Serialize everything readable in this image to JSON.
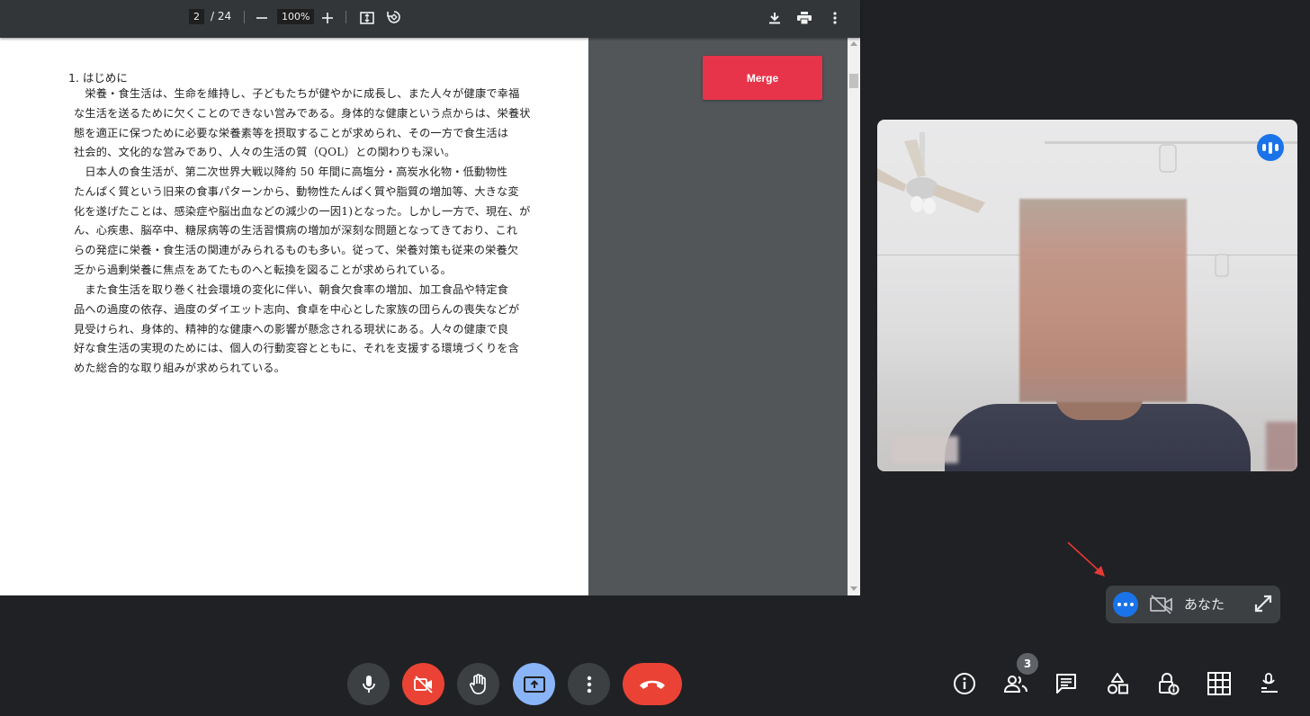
{
  "pdf_viewer": {
    "current_page": "2",
    "total_pages": "/ 24",
    "zoom": "100%",
    "heading": "1. はじめに",
    "paragraphs": [
      [
        "　栄養・食生活は、生命を維持し、子どもたちが健やかに成長し、また人々が健康で幸福",
        "な生活を送るために欠くことのできない営みである。身体的な健康という点からは、栄養状",
        "態を適正に保つために必要な栄養素等を摂取することが求められ、その一方で食生活は",
        "社会的、文化的な営みであり、人々の生活の質（QOL）との関わりも深い。"
      ],
      [
        "　日本人の食生活が、第二次世界大戦以降約 50 年間に高塩分・高炭水化物・低動物性",
        "たんぱく質という旧来の食事パターンから、動物性たんぱく質や脂質の増加等、大きな変",
        "化を遂げたことは、感染症や脳出血などの減少の一因1)となった。しかし一方で、現在、が",
        "ん、心疾患、脳卒中、糖尿病等の生活習慣病の増加が深刻な問題となってきており、これ",
        "らの発症に栄養・食生活の関連がみられるものも多い。従って、栄養対策も従来の栄養欠",
        "乏から過剰栄養に焦点をあてたものへと転換を図ることが求められている。"
      ],
      [
        "　また食生活を取り巻く社会環境の変化に伴い、朝食欠食率の増加、加工食品や特定食",
        "品への過度の依存、過度のダイエット志向、食卓を中心とした家族の団らんの喪失などが",
        "見受けられ、身体的、精神的な健康への影響が懸念される現状にある。人々の健康で良",
        "好な食生活の実現のためには、個人の行動変容とともに、それを支援する環境づくりを含",
        "めた総合的な取り組みが求められている。"
      ]
    ]
  },
  "merge_button": {
    "label": "Merge"
  },
  "self_view": {
    "name": "あなた"
  },
  "participants_count": "3",
  "colors": {
    "end_call": "#ea4335",
    "present_active": "#8ab4f8",
    "accent_blue": "#1a73e8",
    "merge_red": "#e8344a"
  },
  "icons": {
    "toolbar": [
      "minus-icon",
      "plus-icon",
      "fit-page-icon",
      "rotate-icon",
      "download-icon",
      "print-icon",
      "more-vert-icon"
    ],
    "controls": [
      "mic-icon",
      "camera-off-icon",
      "raise-hand-icon",
      "present-screen-icon",
      "more-vert-icon",
      "end-call-icon"
    ],
    "side": [
      "info-icon",
      "people-icon",
      "chat-icon",
      "activities-icon",
      "host-controls-icon",
      "grid-icon",
      "transcript-icon"
    ]
  }
}
